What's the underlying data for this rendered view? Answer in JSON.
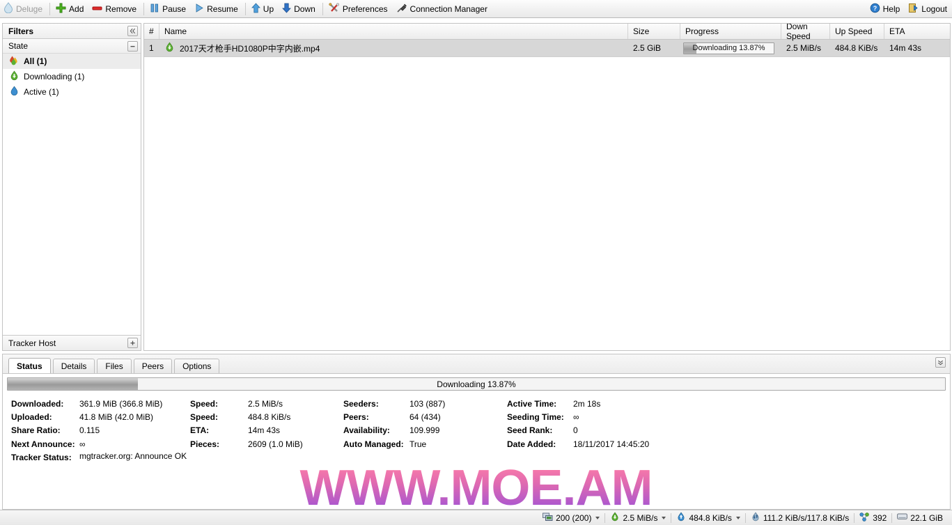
{
  "toolbar": {
    "brand": "Deluge",
    "items": [
      {
        "label": "Add",
        "icon": "plus-icon"
      },
      {
        "label": "Remove",
        "icon": "minus-icon"
      },
      {
        "label": "Pause",
        "icon": "pause-icon"
      },
      {
        "label": "Resume",
        "icon": "play-icon"
      },
      {
        "label": "Up",
        "icon": "arrow-up-icon"
      },
      {
        "label": "Down",
        "icon": "arrow-down-icon"
      },
      {
        "label": "Preferences",
        "icon": "tools-icon"
      },
      {
        "label": "Connection Manager",
        "icon": "plug-icon"
      }
    ],
    "help": "Help",
    "logout": "Logout"
  },
  "sidebar": {
    "title": "Filters",
    "collapse_icon": "chevron-double-left-icon",
    "group": {
      "label": "State",
      "collapse_icon": "minus-icon"
    },
    "items": [
      {
        "label": "All (1)",
        "icon": "all-drop-icon",
        "selected": true
      },
      {
        "label": "Downloading (1)",
        "icon": "download-drop-icon",
        "selected": false
      },
      {
        "label": "Active (1)",
        "icon": "active-drop-icon",
        "selected": false
      }
    ],
    "footer": {
      "label": "Tracker Host",
      "expand_icon": "plus-icon"
    }
  },
  "list": {
    "columns": [
      {
        "key": "num",
        "label": "#"
      },
      {
        "key": "name",
        "label": "Name"
      },
      {
        "key": "size",
        "label": "Size"
      },
      {
        "key": "progress",
        "label": "Progress"
      },
      {
        "key": "down",
        "label": "Down Speed"
      },
      {
        "key": "up",
        "label": "Up Speed"
      },
      {
        "key": "eta",
        "label": "ETA"
      }
    ],
    "rows": [
      {
        "num": "1",
        "icon": "downloading-drop-icon",
        "name": "2017天才枪手HD1080P中字内嵌.mp4",
        "size": "2.5 GiB",
        "progress_label": "Downloading 13.87%",
        "progress_percent": 13.87,
        "down": "2.5 MiB/s",
        "up": "484.8 KiB/s",
        "eta": "14m 43s"
      }
    ]
  },
  "details": {
    "tabs": [
      {
        "label": "Status",
        "active": true
      },
      {
        "label": "Details",
        "active": false
      },
      {
        "label": "Files",
        "active": false
      },
      {
        "label": "Peers",
        "active": false
      },
      {
        "label": "Options",
        "active": false
      }
    ],
    "collapse_icon": "chevron-double-down-icon",
    "progress": {
      "label": "Downloading 13.87%",
      "percent": 13.87
    },
    "status": {
      "col1": [
        {
          "label": "Downloaded:",
          "value": "361.9 MiB (366.8 MiB)"
        },
        {
          "label": "Uploaded:",
          "value": "41.8 MiB (42.0 MiB)"
        },
        {
          "label": "Share Ratio:",
          "value": "0.115"
        },
        {
          "label": "Next Announce:",
          "value": "∞"
        },
        {
          "label": "Tracker Status:",
          "value": "mgtracker.org: Announce OK"
        }
      ],
      "col2": [
        {
          "label": "Speed:",
          "value": "2.5 MiB/s"
        },
        {
          "label": "Speed:",
          "value": "484.8 KiB/s"
        },
        {
          "label": "ETA:",
          "value": "14m 43s"
        },
        {
          "label": "Pieces:",
          "value": "2609 (1.0 MiB)"
        }
      ],
      "col3": [
        {
          "label": "Seeders:",
          "value": "103 (887)"
        },
        {
          "label": "Peers:",
          "value": "64 (434)"
        },
        {
          "label": "Availability:",
          "value": "109.999"
        },
        {
          "label": "Auto Managed:",
          "value": "True"
        }
      ],
      "col4": [
        {
          "label": "Active Time:",
          "value": "2m 18s"
        },
        {
          "label": "Seeding Time:",
          "value": "∞"
        },
        {
          "label": "Seed Rank:",
          "value": "0"
        },
        {
          "label": "Date Added:",
          "value": "18/11/2017 14:45:20"
        }
      ]
    }
  },
  "watermark": "WWW.MOE.AM",
  "statusbar": {
    "items": [
      {
        "label": "200 (200)",
        "icon": "connections-icon",
        "dropdown": true
      },
      {
        "label": "2.5 MiB/s",
        "icon": "download-drop-icon",
        "dropdown": true
      },
      {
        "label": "484.8 KiB/s",
        "icon": "upload-drop-icon",
        "dropdown": true
      },
      {
        "label": "111.2 KiB/s/117.8 KiB/s",
        "icon": "transfer-icon",
        "dropdown": false
      },
      {
        "label": "392",
        "icon": "dht-icon",
        "dropdown": false
      },
      {
        "label": "22.1 GiB",
        "icon": "disk-icon",
        "dropdown": false
      }
    ]
  },
  "colors": {
    "accent_green": "#4fa832",
    "accent_blue": "#3d8fd1",
    "watermark_start": "#ff7fa8",
    "watermark_end": "#9b52d8",
    "selected_row": "#d7d7d7"
  }
}
